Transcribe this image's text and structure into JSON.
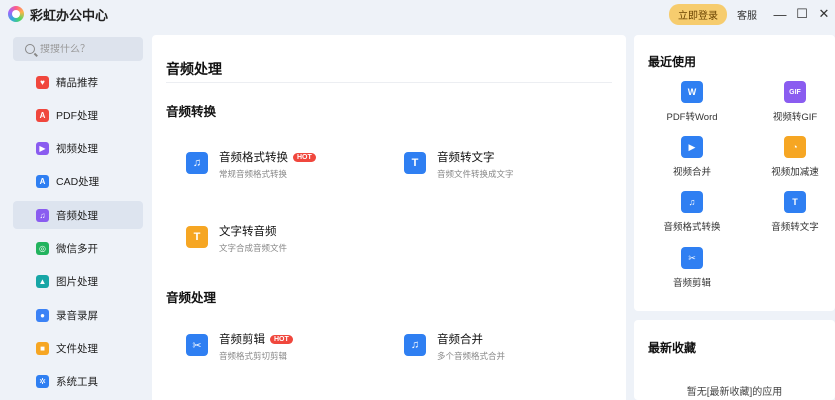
{
  "app": {
    "title": "彩虹办公中心",
    "login_label": "立即登录",
    "service_label": "客服"
  },
  "window": {
    "minimize": "—",
    "maximize": "☐",
    "close": "✕"
  },
  "search": {
    "placeholder": "搜搜什么？"
  },
  "sidebar": {
    "items": [
      {
        "label": "精品推荐",
        "icon": "gift-icon",
        "color": "#f0473d",
        "glyph": "♥"
      },
      {
        "label": "PDF处理",
        "icon": "pdf-icon",
        "color": "#f0473d",
        "glyph": "A"
      },
      {
        "label": "视频处理",
        "icon": "video-icon",
        "color": "#8a5cf0",
        "glyph": "▶"
      },
      {
        "label": "CAD处理",
        "icon": "cad-icon",
        "color": "#2f7ff2",
        "glyph": "A"
      },
      {
        "label": "音频处理",
        "icon": "audio-icon",
        "color": "#8a5cf0",
        "glyph": "♫"
      },
      {
        "label": "微信多开",
        "icon": "wechat-icon",
        "color": "#22b35e",
        "glyph": "◎"
      },
      {
        "label": "图片处理",
        "icon": "image-icon",
        "color": "#17a6a6",
        "glyph": "▲"
      },
      {
        "label": "录音录屏",
        "icon": "microphone-icon",
        "color": "#3b82f6",
        "glyph": "●"
      },
      {
        "label": "文件处理",
        "icon": "folder-icon",
        "color": "#f6a623",
        "glyph": "■"
      },
      {
        "label": "系统工具",
        "icon": "gear-icon",
        "color": "#2f7ff2",
        "glyph": "✲"
      }
    ],
    "active_index": 4
  },
  "main": {
    "title": "音频处理",
    "sections": [
      {
        "title": "音频转换",
        "tools": [
          {
            "name": "音频格式转换",
            "desc": "常规音频格式转换",
            "hot": "HOT",
            "icon": "audio-convert-icon",
            "glyph": "♫"
          },
          {
            "name": "音频转文字",
            "desc": "音频文件转换成文字",
            "hot": "",
            "icon": "audio-to-text-icon",
            "glyph": "T"
          },
          {
            "name": "文字转音频",
            "desc": "文字合成音频文件",
            "hot": "",
            "icon": "text-to-audio-icon",
            "glyph": "T"
          }
        ]
      },
      {
        "title": "音频处理",
        "tools": [
          {
            "name": "音频剪辑",
            "desc": "音频格式剪切剪辑",
            "hot": "HOT",
            "icon": "audio-cut-icon",
            "glyph": "✂"
          },
          {
            "name": "音频合并",
            "desc": "多个音频格式合并",
            "hot": "",
            "icon": "audio-merge-icon",
            "glyph": "♫"
          }
        ]
      }
    ]
  },
  "recent": {
    "title": "最近使用",
    "items": [
      {
        "label": "PDF转Word",
        "icon": "pdf-to-word-icon",
        "glyph": "W"
      },
      {
        "label": "视频转GIF",
        "icon": "video-to-gif-icon",
        "glyph": "GIF"
      },
      {
        "label": "视频合并",
        "icon": "video-merge-icon",
        "glyph": "▶"
      },
      {
        "label": "视频加减速",
        "icon": "video-speed-icon",
        "glyph": "◔"
      },
      {
        "label": "音频格式转换",
        "icon": "audio-convert-icon",
        "glyph": "♫"
      },
      {
        "label": "音频转文字",
        "icon": "audio-to-text-icon",
        "glyph": "T"
      },
      {
        "label": "音频剪辑",
        "icon": "audio-cut-icon",
        "glyph": "✂"
      }
    ]
  },
  "favorites": {
    "title": "最新收藏",
    "empty_text": "暂无[最新收藏]的应用"
  }
}
